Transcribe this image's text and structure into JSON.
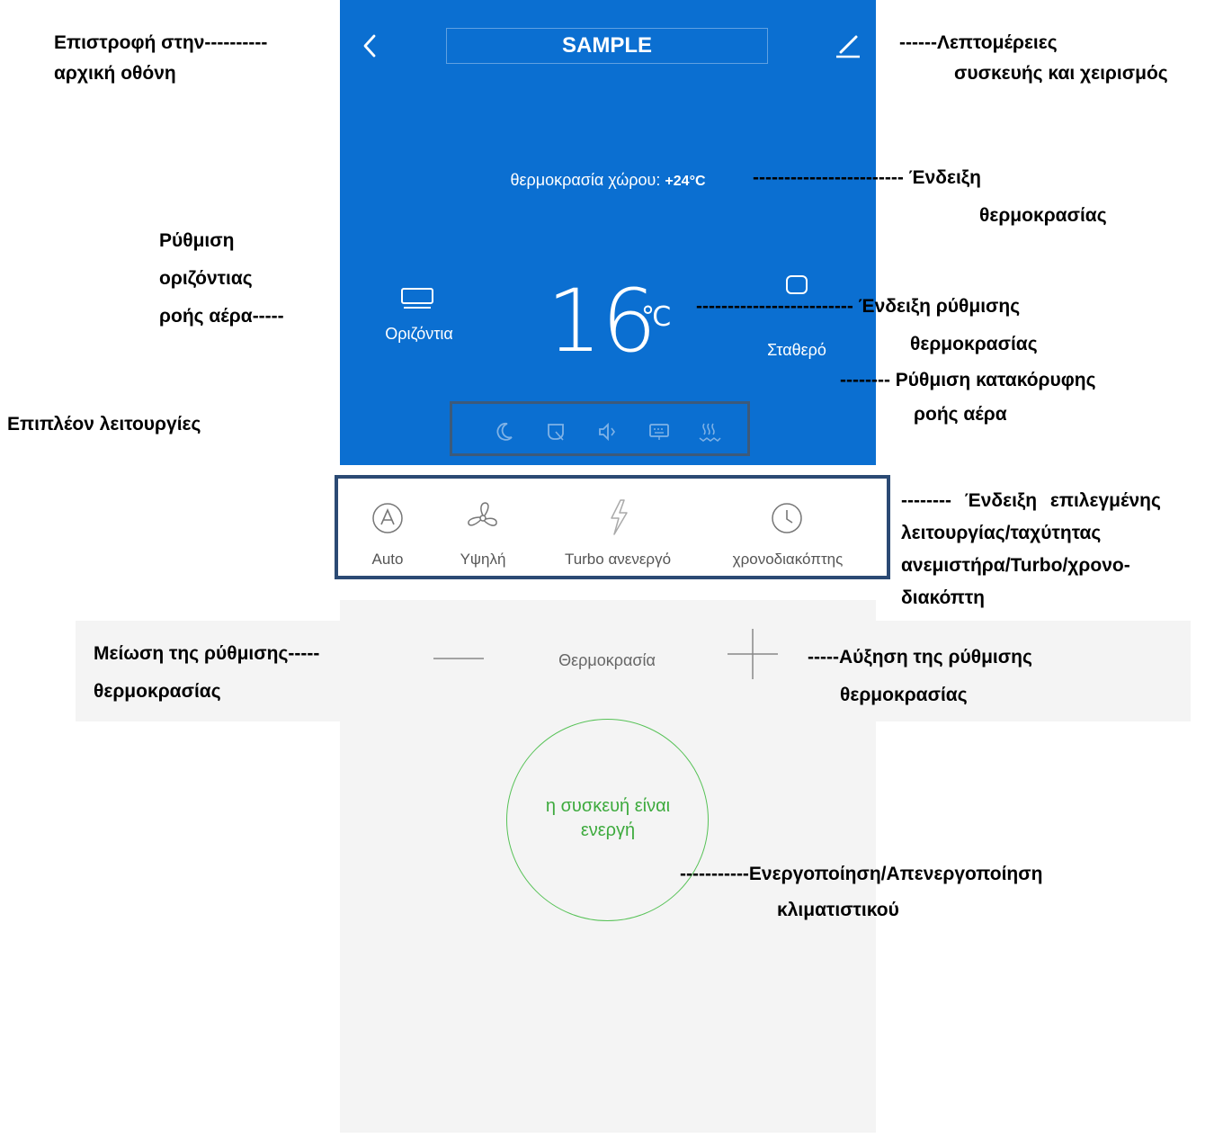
{
  "header": {
    "title": "SAMPLE",
    "back_icon": "chevron-left-icon",
    "edit_icon": "pencil-icon"
  },
  "room": {
    "label": "θερμοκρασία χώρου:",
    "value": "+24°C"
  },
  "setpoint": {
    "value": "16",
    "unit": "℃"
  },
  "swing": {
    "horizontal_label": "Οριζόντια",
    "vertical_label": "Σταθερό"
  },
  "functions": [
    "moon-icon",
    "leaf-icon",
    "speaker-icon",
    "display-icon",
    "heat-icon"
  ],
  "modes": [
    {
      "label": "Auto",
      "icon": "auto-icon"
    },
    {
      "label": "Υψηλή",
      "icon": "fan-icon"
    },
    {
      "label": "Turbo ανενεργό",
      "icon": "bolt-icon"
    },
    {
      "label": "χρονοδιακόπτης",
      "icon": "clock-icon"
    }
  ],
  "temperature_row": {
    "label": "Θερμοκρασία"
  },
  "power": {
    "line1": "η συσκευή είναι",
    "line2": "ενεργή"
  },
  "annotations": {
    "back": [
      "Επιστροφή στην----------",
      "αρχική οθόνη"
    ],
    "details": [
      "------Λεπτομέρειες",
      "συσκευής και χειρισμός"
    ],
    "temp_display": [
      "------------------------ Ένδειξη",
      "θερμοκρασίας"
    ],
    "horizontal": [
      "Ρύθμιση",
      "οριζόντιας",
      "ροής αέρα-----"
    ],
    "setpoint": [
      "------------------------- Ένδειξη ρύθμισης",
      "θερμοκρασίας"
    ],
    "vertical": [
      "-------- Ρύθμιση κατακόρυφης",
      "ροής αέρα"
    ],
    "extra": "Επιπλέον λειτουργίες",
    "mode": [
      "-------- Ένδειξη επιλεγμένης",
      "λειτουργίας/ταχύτητας",
      "ανεμιστήρα/Turbo/χρονο-",
      "διακόπτη"
    ],
    "decrease": [
      "Μείωση της ρύθμισης-----",
      "θερμοκρασίας"
    ],
    "increase": [
      "-----Αύξηση της ρύθμισης",
      "θερμοκρασίας"
    ],
    "power": [
      "-----------Ενεργοποίηση/Απενεργοποίηση",
      "κλιματιστικού"
    ]
  }
}
